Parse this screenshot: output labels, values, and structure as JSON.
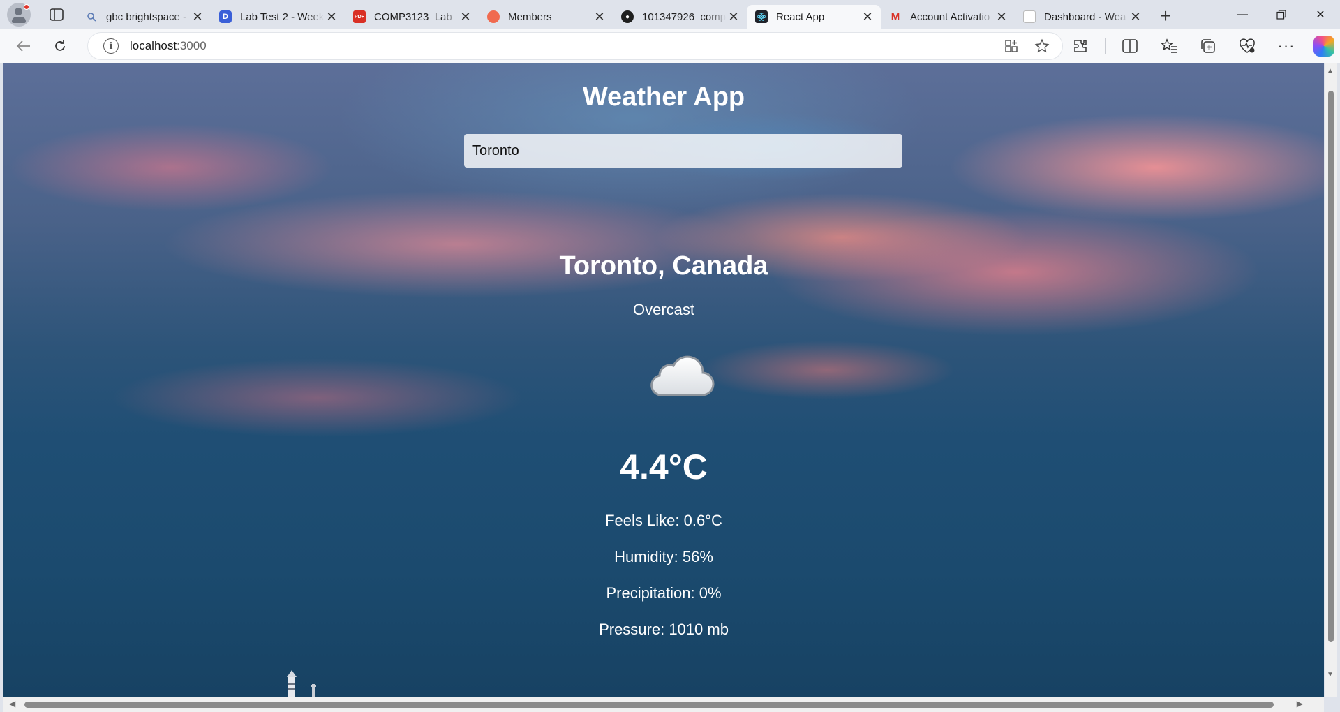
{
  "browser": {
    "tabs": [
      {
        "title": "gbc brightspace -",
        "icon": "search-icon"
      },
      {
        "title": "Lab Test 2 - Week",
        "icon": "brightspace-icon"
      },
      {
        "title": "COMP3123_Lab_T",
        "icon": "pdf-icon"
      },
      {
        "title": "Members",
        "icon": "members-icon"
      },
      {
        "title": "101347926_comp",
        "icon": "github-icon"
      },
      {
        "title": "React App",
        "icon": "react-icon",
        "active": true
      },
      {
        "title": "Account Activatio",
        "icon": "gmail-icon"
      },
      {
        "title": "Dashboard - Wea",
        "icon": "page-icon"
      }
    ],
    "address": {
      "host": "localhost",
      "port": ":3000"
    }
  },
  "app": {
    "title": "Weather App",
    "search_value": "Toronto",
    "location": "Toronto, Canada",
    "condition": "Overcast",
    "condition_icon": "cloud-icon",
    "temperature": "4.4°C",
    "feels_like": "Feels Like: 0.6°C",
    "humidity": "Humidity: 56%",
    "precipitation": "Precipitation: 0%",
    "pressure": "Pressure: 1010 mb"
  },
  "colors": {
    "text": "#ffffff",
    "sky_top": "#5d6f99",
    "sky_bottom": "#174263",
    "cloud_pink": "#f0828c"
  }
}
